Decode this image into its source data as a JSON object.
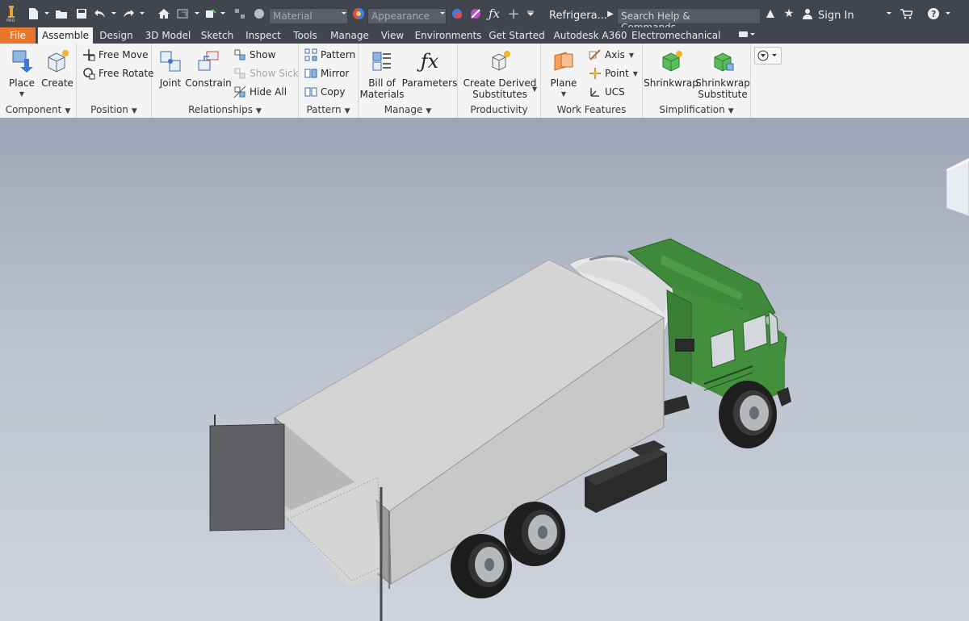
{
  "app": {
    "document_title": "Refrigera...",
    "search_placeholder": "Search Help & Commands...",
    "sign_in": "Sign In",
    "material_placeholder": "Material",
    "appearance_placeholder": "Appearance"
  },
  "tabs": [
    {
      "label": "File"
    },
    {
      "label": "Assemble"
    },
    {
      "label": "Design"
    },
    {
      "label": "3D Model"
    },
    {
      "label": "Sketch"
    },
    {
      "label": "Inspect"
    },
    {
      "label": "Tools"
    },
    {
      "label": "Manage"
    },
    {
      "label": "View"
    },
    {
      "label": "Environments"
    },
    {
      "label": "Get Started"
    },
    {
      "label": "Autodesk A360"
    },
    {
      "label": "Electromechanical"
    }
  ],
  "ribbon": {
    "component": {
      "label": "Component",
      "place": "Place",
      "create": "Create"
    },
    "position": {
      "label": "Position",
      "free_move": "Free Move",
      "free_rotate": "Free Rotate"
    },
    "relationships": {
      "label": "Relationships",
      "joint": "Joint",
      "constrain": "Constrain",
      "show": "Show",
      "show_sick": "Show Sick",
      "hide_all": "Hide All"
    },
    "pattern": {
      "label": "Pattern",
      "pattern": "Pattern",
      "mirror": "Mirror",
      "copy": "Copy"
    },
    "manage": {
      "label": "Manage",
      "bom_line1": "Bill of",
      "bom_line2": "Materials",
      "parameters": "Parameters"
    },
    "productivity": {
      "label": "Productivity",
      "cds_line1": "Create Derived",
      "cds_line2": "Substitutes"
    },
    "work_features": {
      "label": "Work Features",
      "plane": "Plane",
      "axis": "Axis",
      "point": "Point",
      "ucs": "UCS"
    },
    "simplification": {
      "label": "Simplification",
      "shrinkwrap": "Shrinkwrap",
      "sws_line1": "Shrinkwrap",
      "sws_line2": "Substitute"
    }
  },
  "colors": {
    "file_tab": "#e8762d",
    "titlebar": "#41464e",
    "truck_cab": "#3f8a3a",
    "box_body": "#d8d8d8"
  }
}
